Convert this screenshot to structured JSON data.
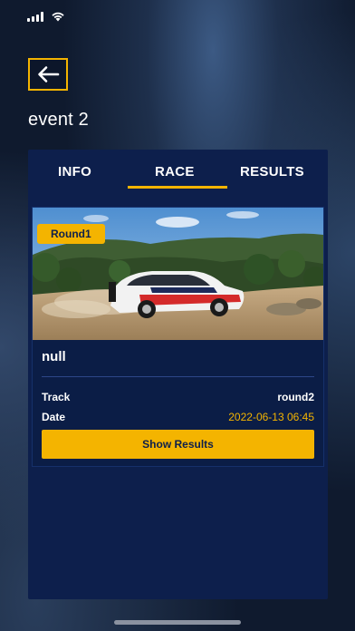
{
  "header": {
    "title": "event 2",
    "back_icon": "arrow-left-icon"
  },
  "tabs": [
    {
      "label": "INFO",
      "active": false
    },
    {
      "label": "RACE",
      "active": true
    },
    {
      "label": "RESULTS",
      "active": false
    }
  ],
  "race_card": {
    "badge": "Round1",
    "name": "null",
    "track_label": "Track",
    "track_value": "round2",
    "date_label": "Date",
    "date_value": "2022-06-13 06:45",
    "button_label": "Show Results"
  },
  "colors": {
    "accent": "#f4b400",
    "panel": "#0d1f4c",
    "background": "#0f1a2e"
  }
}
